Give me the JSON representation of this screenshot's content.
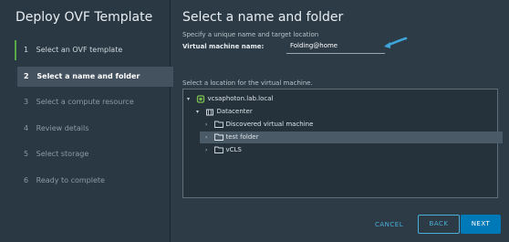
{
  "wizard": {
    "title": "Deploy OVF Template",
    "steps": [
      {
        "number": "1",
        "label": "Select an OVF template",
        "state": "done"
      },
      {
        "number": "2",
        "label": "Select a name and folder",
        "state": "active"
      },
      {
        "number": "3",
        "label": "Select a compute resource",
        "state": "pending"
      },
      {
        "number": "4",
        "label": "Review details",
        "state": "pending"
      },
      {
        "number": "5",
        "label": "Select storage",
        "state": "pending"
      },
      {
        "number": "6",
        "label": "Ready to complete",
        "state": "pending"
      }
    ]
  },
  "main": {
    "title": "Select a name and folder",
    "subtitle": "Specify a unique name and target location",
    "vm_name_label": "Virtual machine name:",
    "vm_name_value": "Folding@home",
    "location_label": "Select a location for the virtual machine.",
    "tree": [
      {
        "label": "vcsaphoton.lab.local",
        "icon": "vcenter-icon",
        "caret": "▾"
      },
      {
        "label": "Datacenter",
        "icon": "datacenter-icon",
        "caret": "▾"
      },
      {
        "label": "Discovered virtual machine",
        "icon": "folder-icon",
        "caret": "›"
      },
      {
        "label": "test folder",
        "icon": "folder-icon",
        "caret": "›",
        "selected": true
      },
      {
        "label": "vCLS",
        "icon": "folder-icon",
        "caret": "›"
      }
    ]
  },
  "footer": {
    "cancel_label": "CANCEL",
    "back_label": "BACK",
    "next_label": "NEXT"
  },
  "colors": {
    "accent": "#49afd9",
    "primary_button": "#0079b8",
    "done_marker": "#57a947",
    "vcenter_green": "#7bc14e"
  }
}
